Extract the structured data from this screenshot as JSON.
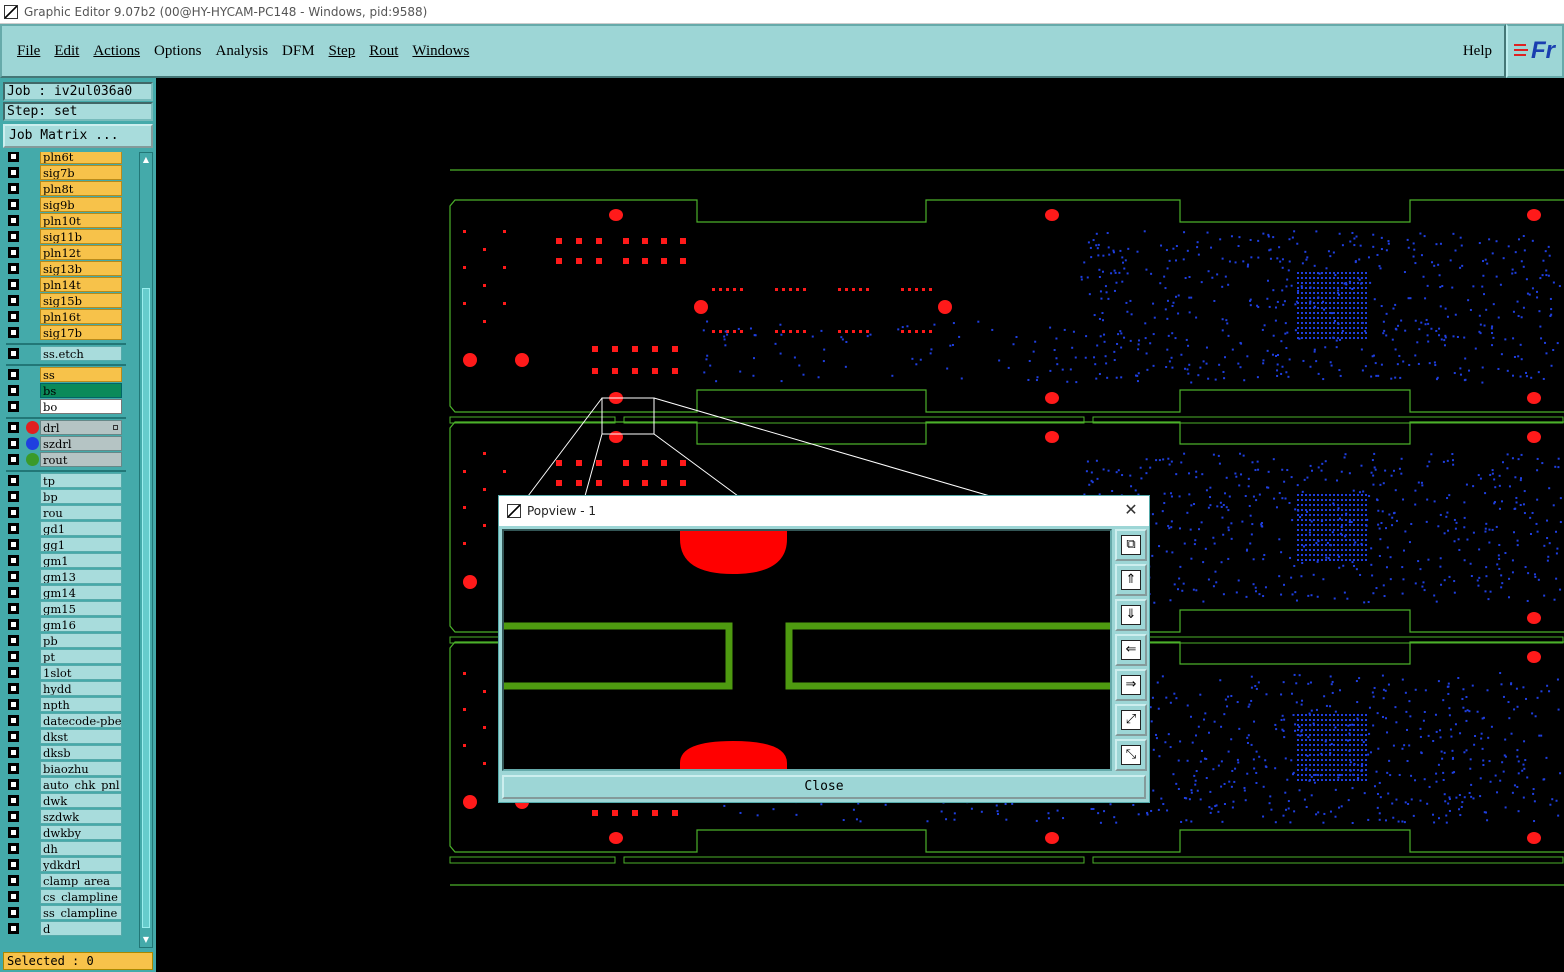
{
  "window": {
    "title": "Graphic Editor 9.07b2 (00@HY-HYCAM-PC148 - Windows, pid:9588)"
  },
  "menu": {
    "items": [
      "File",
      "Edit",
      "Actions",
      "Options",
      "Analysis",
      "DFM",
      "Step",
      "Rout",
      "Windows"
    ],
    "help": "Help"
  },
  "logo": {
    "text": "Fr",
    "colors": {
      "text": "#1a3fb0",
      "lines": "#dd2222"
    }
  },
  "job_info": {
    "job": "Job : iv2ul036a0",
    "step": "Step: set",
    "job_matrix": "Job Matrix ..."
  },
  "layers": [
    {
      "name": "pln6t",
      "color": "orange"
    },
    {
      "name": "sig7b",
      "color": "orange"
    },
    {
      "name": "pln8t",
      "color": "orange"
    },
    {
      "name": "sig9b",
      "color": "orange"
    },
    {
      "name": "pln10t",
      "color": "orange"
    },
    {
      "name": "sig11b",
      "color": "orange"
    },
    {
      "name": "pln12t",
      "color": "orange"
    },
    {
      "name": "sig13b",
      "color": "orange"
    },
    {
      "name": "pln14t",
      "color": "orange"
    },
    {
      "name": "sig15b",
      "color": "orange"
    },
    {
      "name": "pln16t",
      "color": "orange"
    },
    {
      "name": "sig17b",
      "color": "orange"
    },
    {
      "name": "ss.etch",
      "color": "teal"
    },
    {
      "name": "ss",
      "color": "orange"
    },
    {
      "name": "bs",
      "color": "green"
    },
    {
      "name": "bo",
      "color": "white"
    },
    {
      "name": "drl",
      "color": "gray",
      "dot": "#e02020"
    },
    {
      "name": "szdrl",
      "color": "gray",
      "dot": "#1f3fe0"
    },
    {
      "name": "rout",
      "color": "gray",
      "dot": "#3a9a2a"
    },
    {
      "name": "tp",
      "color": "teal"
    },
    {
      "name": "bp",
      "color": "teal"
    },
    {
      "name": "rou",
      "color": "teal"
    },
    {
      "name": "gd1",
      "color": "teal"
    },
    {
      "name": "gg1",
      "color": "teal"
    },
    {
      "name": "gm1",
      "color": "teal"
    },
    {
      "name": "gm13",
      "color": "teal"
    },
    {
      "name": "gm14",
      "color": "teal"
    },
    {
      "name": "gm15",
      "color": "teal"
    },
    {
      "name": "gm16",
      "color": "teal"
    },
    {
      "name": "pb",
      "color": "teal"
    },
    {
      "name": "pt",
      "color": "teal"
    },
    {
      "name": "1slot",
      "color": "teal"
    },
    {
      "name": "hydd",
      "color": "teal"
    },
    {
      "name": "npth",
      "color": "teal"
    },
    {
      "name": "datecode-pbe",
      "color": "teal"
    },
    {
      "name": "dkst",
      "color": "teal"
    },
    {
      "name": "dksb",
      "color": "teal"
    },
    {
      "name": "biaozhu",
      "color": "teal"
    },
    {
      "name": "auto_chk_pnl",
      "color": "teal"
    },
    {
      "name": "dwk",
      "color": "teal"
    },
    {
      "name": "szdwk",
      "color": "teal"
    },
    {
      "name": "dwkby",
      "color": "teal"
    },
    {
      "name": "dh",
      "color": "teal"
    },
    {
      "name": "ydkdrl",
      "color": "teal"
    },
    {
      "name": "clamp_area",
      "color": "teal"
    },
    {
      "name": "cs_clampline",
      "color": "teal"
    },
    {
      "name": "ss_clampline",
      "color": "teal"
    },
    {
      "name": "d",
      "color": "teal"
    }
  ],
  "status": {
    "selected": "Selected : 0"
  },
  "popview": {
    "title": "Popview - 1",
    "close_label": "Close",
    "tools": [
      "zoom-window-icon",
      "pan-up-icon",
      "pan-down-icon",
      "pan-left-icon",
      "pan-right-icon",
      "zoom-in-icon",
      "zoom-out-icon"
    ]
  },
  "colors": {
    "background": "#000000",
    "panel": "#9dd6d6",
    "layer_active": "#f7c24a",
    "drill": "#ff1a1a",
    "rout": "#3a9a2a",
    "szdrl": "#1f3fe0",
    "outline": "#4bb02a"
  }
}
